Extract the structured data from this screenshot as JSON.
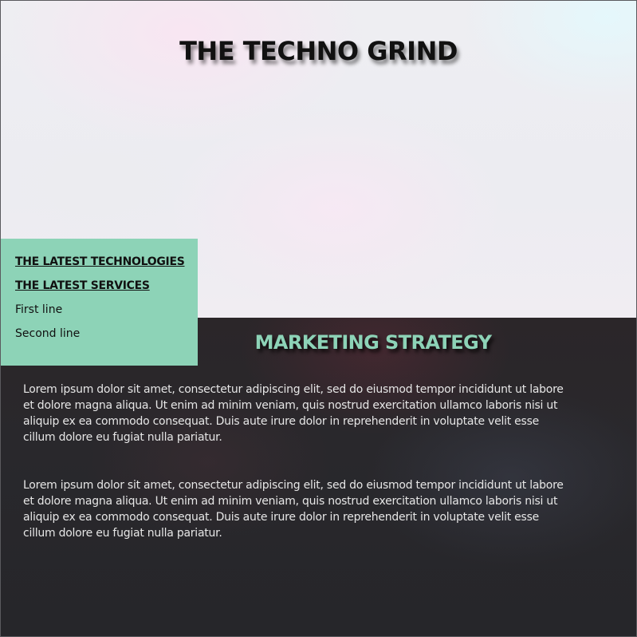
{
  "header": {
    "title": "THE TECHNO GRIND"
  },
  "sidebar": {
    "items": [
      {
        "label": "THE LATEST TECHNOLOGIES",
        "link": true
      },
      {
        "label": "THE LATEST SERVICES",
        "link": true
      },
      {
        "label": "First line",
        "link": false
      },
      {
        "label": "Second line",
        "link": false
      }
    ]
  },
  "main": {
    "heading": "MARKETING STRATEGY",
    "paragraphs": [
      "Lorem ipsum dolor sit amet, consectetur adipiscing elit, sed do eiusmod tempor incididunt ut labore et dolore magna aliqua. Ut enim ad minim veniam, quis nostrud exercitation ullamco laboris nisi ut aliquip ex ea commodo consequat. Duis aute irure dolor in reprehenderit in voluptate velit esse cillum dolore eu fugiat nulla pariatur.",
      "Lorem ipsum dolor sit amet, consectetur adipiscing elit, sed do eiusmod tempor incididunt ut labore et dolore magna aliqua. Ut enim ad minim veniam, quis nostrud exercitation ullamco laboris nisi ut aliquip ex ea commodo consequat. Duis aute irure dolor in reprehenderit in voluptate velit esse cillum dolore eu fugiat nulla pariatur."
    ]
  },
  "colors": {
    "accent": "#8dd3b7",
    "dark_background": "#28272b",
    "hero_background": "#eeeef2"
  }
}
